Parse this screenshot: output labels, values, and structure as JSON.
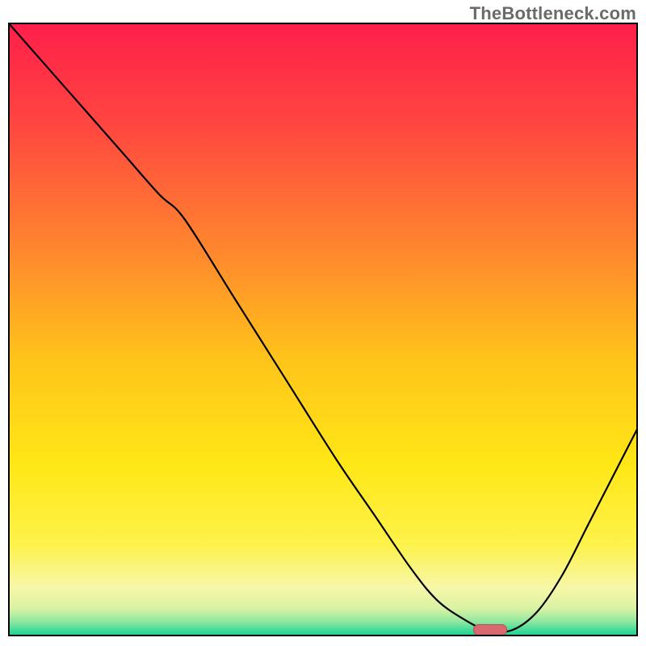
{
  "watermark": {
    "text": "TheBottleneck.com"
  },
  "colors": {
    "gradient_stops": [
      {
        "offset": 0.0,
        "color": "#ff1e4b"
      },
      {
        "offset": 0.18,
        "color": "#ff4a3f"
      },
      {
        "offset": 0.38,
        "color": "#ff8a2d"
      },
      {
        "offset": 0.55,
        "color": "#ffc41a"
      },
      {
        "offset": 0.72,
        "color": "#ffe716"
      },
      {
        "offset": 0.85,
        "color": "#fdf24a"
      },
      {
        "offset": 0.92,
        "color": "#f7f7a8"
      },
      {
        "offset": 0.955,
        "color": "#d9f2a3"
      },
      {
        "offset": 0.975,
        "color": "#93e8a0"
      },
      {
        "offset": 0.99,
        "color": "#43db9a"
      },
      {
        "offset": 1.0,
        "color": "#17cf8e"
      }
    ],
    "curve": "#000000",
    "frame": "#000000",
    "marker_fill": "#d86a6f",
    "marker_stroke": "#bb4f55"
  },
  "chart_data": {
    "type": "line",
    "title": "",
    "xlabel": "",
    "ylabel": "",
    "xlim": [
      0,
      100
    ],
    "ylim": [
      0,
      100
    ],
    "series": [
      {
        "name": "curve",
        "x": [
          0,
          6,
          12,
          18,
          24,
          28,
          36,
          44,
          52,
          58,
          64,
          68,
          72,
          76,
          80,
          84,
          88,
          92,
          96,
          100
        ],
        "y": [
          100,
          93,
          86,
          79,
          72,
          68,
          55,
          42,
          29,
          20,
          11,
          6,
          3,
          1,
          1,
          4,
          10,
          18,
          26,
          34
        ]
      }
    ],
    "marker": {
      "x": 76.5,
      "y": 1.0
    }
  }
}
